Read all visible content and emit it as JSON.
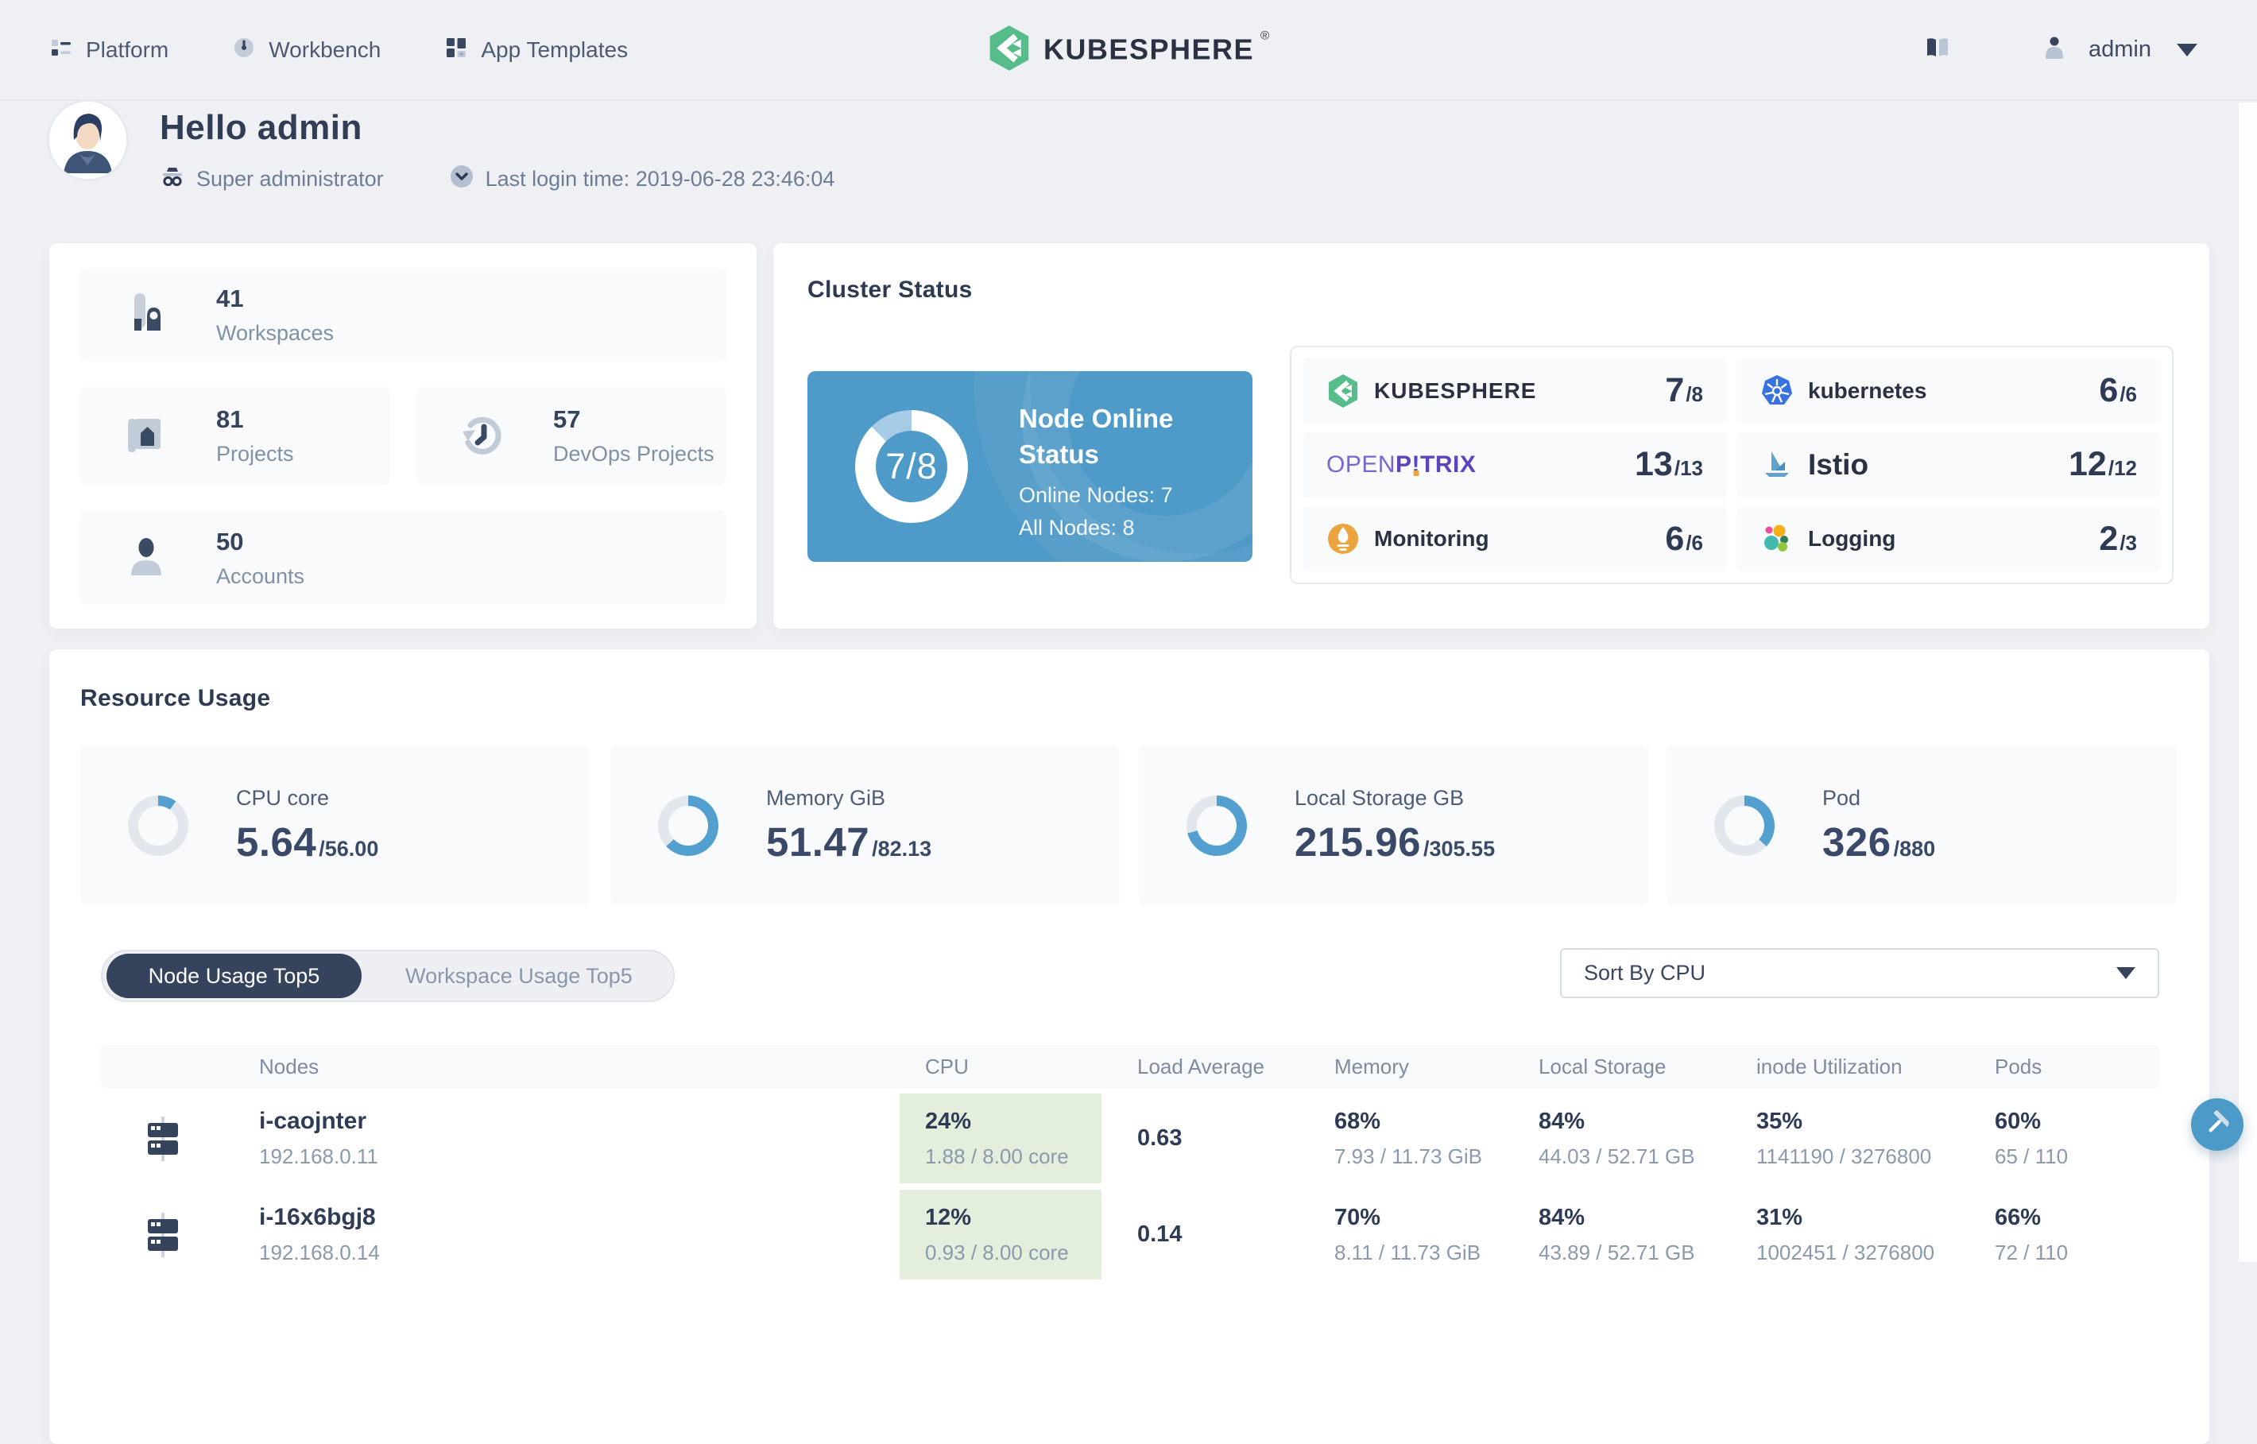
{
  "nav": {
    "items": [
      {
        "label": "Platform"
      },
      {
        "label": "Workbench"
      },
      {
        "label": "App Templates"
      }
    ],
    "logo_text": "KUBESPHERE",
    "logo_reg": "®",
    "user": "admin"
  },
  "header": {
    "greeting": "Hello admin",
    "role": "Super administrator",
    "last_login": "Last login time: 2019-06-28 23:46:04"
  },
  "stats": {
    "workspaces": {
      "value": "41",
      "label": "Workspaces"
    },
    "projects": {
      "value": "81",
      "label": "Projects"
    },
    "devops": {
      "value": "57",
      "label": "DevOps Projects"
    },
    "accounts": {
      "value": "50",
      "label": "Accounts"
    }
  },
  "cluster": {
    "title": "Cluster Status",
    "node_online": {
      "ratio": "7/8",
      "percent": 87.5,
      "title": "Node Online Status",
      "online": "Online Nodes: 7",
      "all": "All Nodes: 8"
    },
    "services": [
      {
        "name": "KUBESPHERE",
        "value": "7",
        "total": "/8"
      },
      {
        "name": "kubernetes",
        "value": "6",
        "total": "/6"
      },
      {
        "name": "OPENP!TRIX",
        "wordmark": {
          "light": "OPEN",
          "bold_p": "P",
          "excl": "!",
          "bold_rest": "TRIX"
        },
        "value": "13",
        "total": "/13"
      },
      {
        "name": "Istio",
        "value": "12",
        "total": "/12"
      },
      {
        "name": "Monitoring",
        "value": "6",
        "total": "/6"
      },
      {
        "name": "Logging",
        "value": "2",
        "total": "/3"
      }
    ]
  },
  "resource_usage": {
    "title": "Resource Usage",
    "metrics": [
      {
        "label": "CPU core",
        "used": "5.64",
        "total": "/56.00",
        "percent": 10
      },
      {
        "label": "Memory GiB",
        "used": "51.47",
        "total": "/82.13",
        "percent": 63
      },
      {
        "label": "Local Storage GB",
        "used": "215.96",
        "total": "/305.55",
        "percent": 71
      },
      {
        "label": "Pod",
        "used": "326",
        "total": "/880",
        "percent": 37
      }
    ],
    "tabs": [
      {
        "label": "Node Usage Top5",
        "active": true
      },
      {
        "label": "Workspace Usage Top5",
        "active": false
      }
    ],
    "sort": "Sort By CPU",
    "table": {
      "columns": [
        "Nodes",
        "CPU",
        "Load Average",
        "Memory",
        "Local Storage",
        "inode Utilization",
        "Pods"
      ],
      "rows": [
        {
          "name": "i-caojnter",
          "ip": "192.168.0.11",
          "cpu_pct": "24%",
          "cpu_detail": "1.88 / 8.00 core",
          "load": "0.63",
          "mem_pct": "68%",
          "mem_detail": "7.93 / 11.73 GiB",
          "storage_pct": "84%",
          "storage_detail": "44.03 / 52.71 GB",
          "inode_pct": "35%",
          "inode_detail": "1141190 / 3276800",
          "pods_pct": "60%",
          "pods_detail": "65 / 110"
        },
        {
          "name": "i-16x6bgj8",
          "ip": "192.168.0.14",
          "cpu_pct": "12%",
          "cpu_detail": "0.93 / 8.00 core",
          "load": "0.14",
          "mem_pct": "70%",
          "mem_detail": "8.11 / 11.73 GiB",
          "storage_pct": "84%",
          "storage_detail": "43.89 / 52.71 GB",
          "inode_pct": "31%",
          "inode_detail": "1002451 / 3276800",
          "pods_pct": "66%",
          "pods_detail": "72 / 110"
        }
      ]
    }
  },
  "colors": {
    "accent_blue": "#4e9ac8",
    "brand_green": "#55bc8a",
    "cpu_cell_green": "#e3eedd",
    "dark_navy": "#36435c"
  }
}
